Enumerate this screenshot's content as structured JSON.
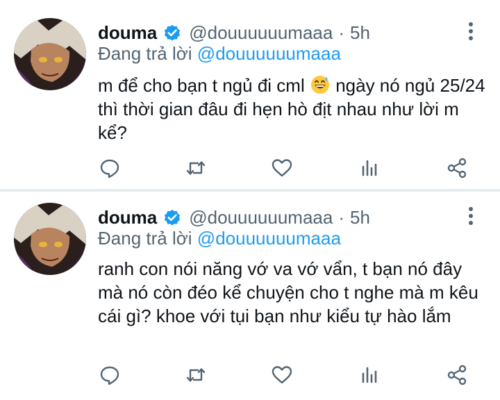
{
  "tweets": [
    {
      "author_name": "douma",
      "handle": "@douuuuuumaaa",
      "separator": "·",
      "time": "5h",
      "reply_prefix": "Đang trả lời",
      "reply_to": "@douuuuuumaaa",
      "text_before_emoji": "m để cho bạn t ngủ đi cml",
      "emoji": "grinning-face-with-sweat",
      "text_after_emoji": "ngày nó ngủ 25/24 thì thời gian đâu đi hẹn hò địt nhau như lời m kể?"
    },
    {
      "author_name": "douma",
      "handle": "@douuuuuumaaa",
      "separator": "·",
      "time": "5h",
      "reply_prefix": "Đang trả lời",
      "reply_to": "@douuuuuumaaa",
      "text": "ranh con nói năng vớ va vớ vẩn, t bạn nó đây mà nó còn đéo kể chuyện cho t nghe mà m kêu cái gì? khoe với tụi bạn như kiểu tự hào lắm"
    }
  ],
  "icons": {
    "verified": "verified-badge-icon",
    "more": "more-vertical-icon",
    "reply": "reply-icon",
    "retweet": "retweet-icon",
    "like": "heart-icon",
    "stats": "analytics-icon",
    "share": "share-icon"
  },
  "colors": {
    "accent": "#1d9bf0",
    "secondary_text": "#536471",
    "primary_text": "#0f1419",
    "separator": "#e6ecf0"
  }
}
